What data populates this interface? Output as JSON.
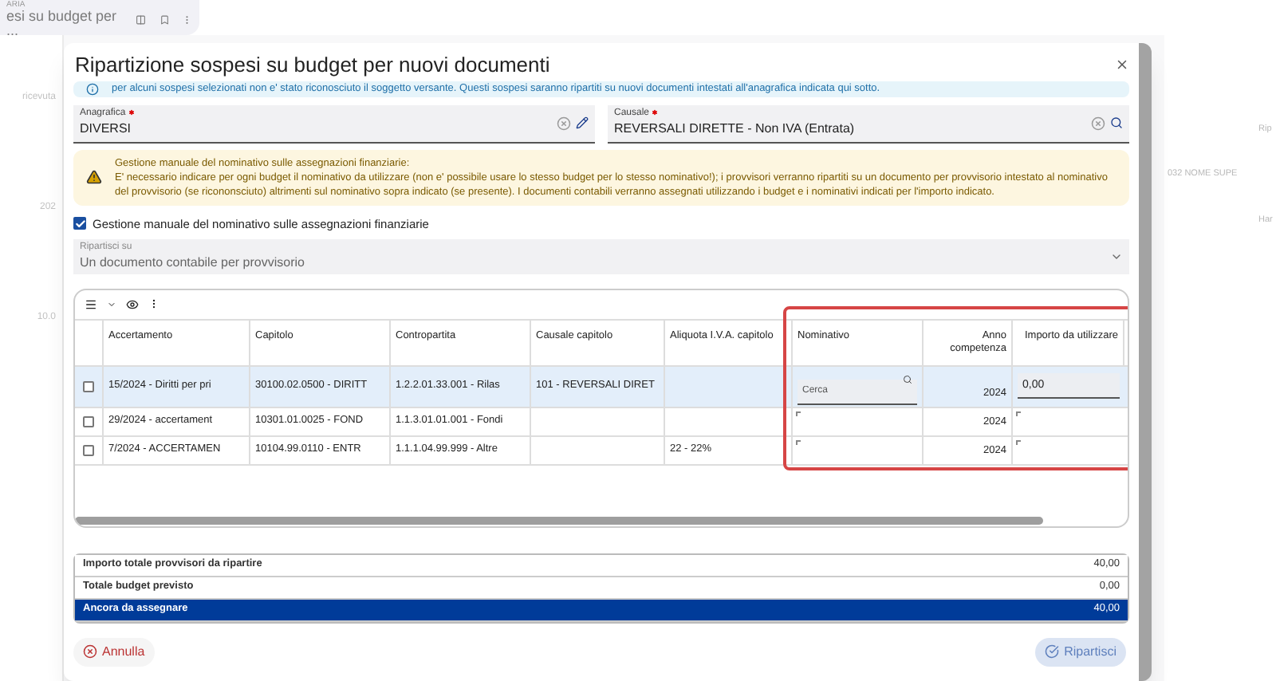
{
  "background": {
    "tab": {
      "overline": "ARIA",
      "title": "esi su budget per ..."
    },
    "left_texts": [
      "ricevuta",
      "202",
      "10.0"
    ],
    "right_texts": [
      "Rip",
      "032 NOME SUPE",
      "Har"
    ]
  },
  "dialog": {
    "title": "Ripartizione sospesi su budget per nuovi documenti",
    "info": "per alcuni sospesi selezionati non e' stato riconosciuto il soggetto versante. Questi sospesi saranno ripartiti su nuovi documenti intestati all'anagrafica indicata qui sotto.",
    "fields": [
      {
        "label": "Anagrafica",
        "required": true,
        "value": "DIVERSI",
        "kind": "edit"
      },
      {
        "label": "Causale",
        "required": true,
        "value": "REVERSALI DIRETTE - Non IVA (Entrata)",
        "kind": "search"
      }
    ],
    "warning": {
      "title": "Gestione manuale del nominativo sulle assegnazioni finanziarie:",
      "text": "E' necessario indicare per ogni budget il nominativo da utilizzare (non e' possibile usare lo stesso budget per lo stesso nominativo!); i provvisori verranno ripartiti su un documento per provvisorio intestato al nominativo del provvisorio (se ricononsciuto) altrimenti sul nominativo sopra indicato (se presente). I documenti contabili verranno assegnati utilizzando i budget e i nominativi indicati per l'importo indicato."
    },
    "manual_checkbox": {
      "label": "Gestione manuale del nominativo sulle assegnazioni finanziarie",
      "checked": true
    },
    "split_select": {
      "label": "Ripartisci su",
      "value": "Un documento contabile per provvisorio"
    },
    "table": {
      "columns": [
        "Accertamento",
        "Capitolo",
        "Contropartita",
        "Causale capitolo",
        "Aliquota I.V.A. capitolo",
        "Nominativo",
        "Anno competenza",
        "Importo da utilizzare"
      ],
      "rows": [
        {
          "selected": true,
          "checked": false,
          "cells": [
            "15/2024 - Diritti per pri",
            "30100.02.0500 - DIRITT",
            "1.2.2.01.33.001 - Rilas",
            "101 - REVERSALI DIRET",
            ""
          ],
          "nominativo_placeholder": "Cerca",
          "anno": "2024",
          "importo": "0,00"
        },
        {
          "selected": false,
          "checked": false,
          "cells": [
            "29/2024 - accertament",
            "10301.01.0025 - FOND",
            "1.1.3.01.01.001 - Fondi",
            "",
            ""
          ],
          "anno": "2024"
        },
        {
          "selected": false,
          "checked": false,
          "cells": [
            "7/2024 - ACCERTAMEN",
            "10104.99.0110 - ENTR",
            "1.1.1.04.99.999 - Altre",
            "",
            "22 - 22%"
          ],
          "anno": "2024"
        }
      ]
    },
    "totals": [
      {
        "label": "Importo totale provvisori da ripartire",
        "value": "40,00",
        "highlight": false
      },
      {
        "label": "Totale budget previsto",
        "value": "0,00",
        "highlight": false
      },
      {
        "label": "Ancora da assegnare",
        "value": "40,00",
        "highlight": true
      }
    ],
    "cancel_button": "Annulla",
    "submit_button": {
      "label": "Ripartisci",
      "disabled": true
    }
  }
}
